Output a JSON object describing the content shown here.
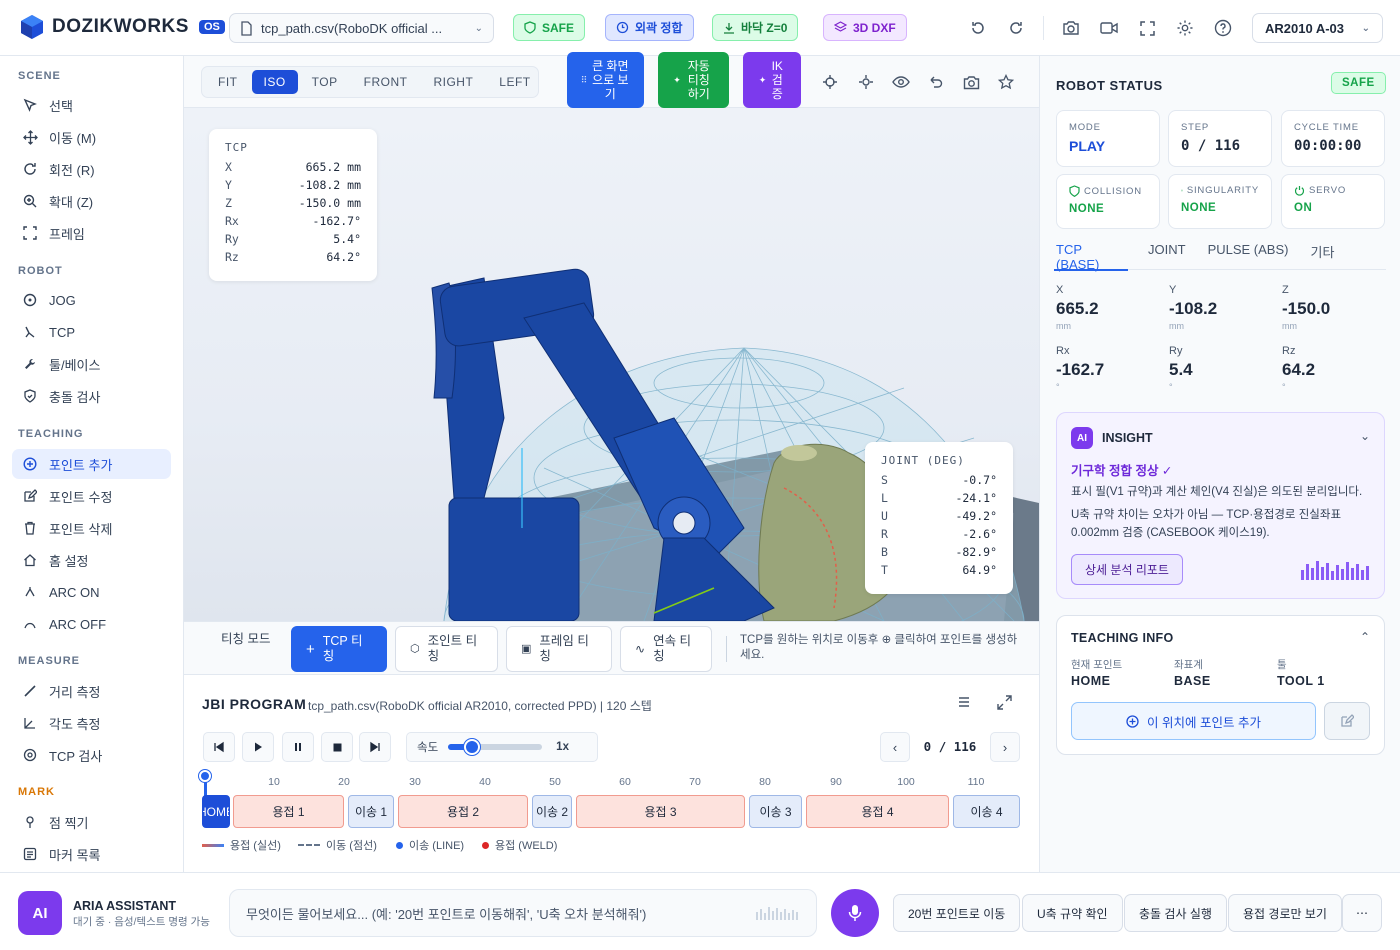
{
  "app": {
    "brand": "DOZIKWORKS",
    "badge": "OS"
  },
  "header": {
    "file": "tcp_path.csv(RoboDK official ...",
    "safe": "SAFE",
    "pills": [
      "외곽 정합",
      "바닥 Z=0",
      "3D DXF"
    ],
    "robot": "AR2010 A-03"
  },
  "sidebar": {
    "scene_title": "SCENE",
    "scene": [
      "선택",
      "이동 (M)",
      "회전 (R)",
      "확대 (Z)",
      "프레임"
    ],
    "robot_title": "ROBOT",
    "robot": [
      "JOG",
      "TCP",
      "툴/베이스",
      "충돌 검사"
    ],
    "teaching_title": "TEACHING",
    "teaching": [
      "포인트 추가",
      "포인트 수정",
      "포인트 삭제",
      "홈 설정",
      "ARC ON",
      "ARC OFF"
    ],
    "measure_title": "MEASURE",
    "measure": [
      "거리 측정",
      "각도 측정",
      "TCP 검사"
    ],
    "mark_title": "MARK",
    "mark": [
      "점 찍기",
      "마커 목록"
    ]
  },
  "viewbar": {
    "views": [
      "FIT",
      "ISO",
      "TOP",
      "FRONT",
      "RIGHT",
      "LEFT"
    ],
    "big_view": "큰 화면으로 보기",
    "auto_teach": "자동 티칭 하기",
    "ik_check": "IK 검증"
  },
  "tcp_card": {
    "title": "TCP",
    "rows": [
      {
        "k": "X",
        "v": "665.2 mm"
      },
      {
        "k": "Y",
        "v": "-108.2 mm"
      },
      {
        "k": "Z",
        "v": "-150.0 mm"
      },
      {
        "k": "Rx",
        "v": "-162.7°"
      },
      {
        "k": "Ry",
        "v": "5.4°"
      },
      {
        "k": "Rz",
        "v": "64.2°"
      }
    ]
  },
  "joint_card": {
    "title": "JOINT (DEG)",
    "rows": [
      {
        "k": "S",
        "v": "-0.7°"
      },
      {
        "k": "L",
        "v": "-24.1°"
      },
      {
        "k": "U",
        "v": "-49.2°"
      },
      {
        "k": "R",
        "v": "-2.6°"
      },
      {
        "k": "B",
        "v": "-82.9°"
      },
      {
        "k": "T",
        "v": "64.9°"
      }
    ]
  },
  "teachbar": {
    "mode_label": "티칭 모드",
    "tcp": "TCP 티칭",
    "joint": "조인트 티칭",
    "frame": "프레임 티칭",
    "continuous": "연속 티칭",
    "hint": "TCP를 원하는 위치로 이동후 ⊕ 클릭하여 포인트를 생성하세요."
  },
  "jbi": {
    "title": "JBI PROGRAM",
    "subtitle": "tcp_path.csv(RoboDK official AR2010, corrected PPD) | 120 스텝",
    "speed_label": "속도",
    "speed_value": "1x",
    "speed_fraction": 0.25,
    "step_display": "0 / 116",
    "ticks": [
      "10",
      "20",
      "30",
      "40",
      "50",
      "60",
      "70",
      "80",
      "90",
      "100",
      "110"
    ],
    "segments": [
      {
        "label": "HOME",
        "type": "h"
      },
      {
        "label": "용접 1",
        "type": "w"
      },
      {
        "label": "이송 1",
        "type": "m"
      },
      {
        "label": "용접 2",
        "type": "w"
      },
      {
        "label": "이송 2",
        "type": "m"
      },
      {
        "label": "용접 3",
        "type": "w"
      },
      {
        "label": "이송 3",
        "type": "m"
      },
      {
        "label": "용접 4",
        "type": "w"
      },
      {
        "label": "이송 4",
        "type": "m"
      }
    ],
    "legend": [
      "용접 (실선)",
      "이동 (점선)",
      "이송 (LINE)",
      "용접 (WELD)"
    ]
  },
  "status": {
    "title": "ROBOT STATUS",
    "safe": "SAFE",
    "mode_label": "MODE",
    "mode": "PLAY",
    "step_label": "STEP",
    "step": "0 / 116",
    "cycle_label": "CYCLE TIME",
    "cycle": "00:00:00",
    "collision_label": "COLLISION",
    "collision": "NONE",
    "singularity_label": "SINGULARITY",
    "singularity": "NONE",
    "servo_label": "SERVO",
    "servo": "ON",
    "tabs": [
      "TCP (BASE)",
      "JOINT",
      "PULSE (ABS)",
      "기타"
    ],
    "coords": [
      {
        "l": "X",
        "v": "665.2",
        "u": "mm"
      },
      {
        "l": "Y",
        "v": "-108.2",
        "u": "mm"
      },
      {
        "l": "Z",
        "v": "-150.0",
        "u": "mm"
      },
      {
        "l": "Rx",
        "v": "-162.7",
        "u": "°"
      },
      {
        "l": "Ry",
        "v": "5.4",
        "u": "°"
      },
      {
        "l": "Rz",
        "v": "64.2",
        "u": "°"
      }
    ]
  },
  "insight": {
    "badge": "AI",
    "title": "INSIGHT",
    "headline": "기구학 정합 정상 ✓",
    "p1": "표시 필(V1 규약)과 계산 체인(V4 진실)은 의도된 분리입니다.",
    "p2": "U축 규약 차이는 오차가 아님 — TCP·용접경로 진실좌표 0.002mm 검증 (CASEBOOK 케이스19).",
    "button": "상세 분석 리포트"
  },
  "teaching_info": {
    "title": "TEACHING INFO",
    "current_label": "현재 포인트",
    "current": "HOME",
    "coord_label": "좌표계",
    "coord": "BASE",
    "tool_label": "툴",
    "tool": "TOOL 1",
    "add_button": "이 위치에 포인트 추가"
  },
  "assistant": {
    "avatar": "AI",
    "name": "ARIA ASSISTANT",
    "status": "대기 중 · 음성/텍스트 명령 가능",
    "placeholder": "무엇이든 물어보세요... (예: '20번 포인트로 이동해줘', 'U축 오차 분석해줘')",
    "quick": [
      "20번 포인트로 이동",
      "U축 규약 확인",
      "충돌 검사 실행",
      "용접 경로만 보기"
    ],
    "more": "⋯"
  }
}
